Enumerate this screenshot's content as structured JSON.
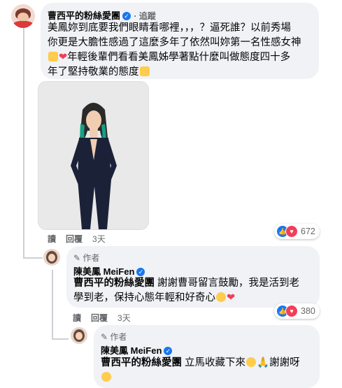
{
  "post_comment": {
    "author": "曹西平的粉絲愛團",
    "follow_label": "追蹤",
    "lines": [
      "美鳳妳到底要我們眼睛看哪裡，，，？逼死誰？以前秀場",
      "你更是大膽性感過了這麼多年了依然叫妳第一名性感女神",
      "年輕後輩們看看美鳳姊學著點什麼叫做態度四十多",
      "年了堅持敬業的態度"
    ],
    "actions": {
      "reply": "讀",
      "comment": "回覆",
      "time": "3天"
    },
    "reaction_count": "672"
  },
  "reply1": {
    "badge": "作者",
    "author": "陳美鳳 MeiFen",
    "mention": "曹西平的粉絲愛團",
    "line1_rest": "謝謝曹哥留言鼓勵，我是活到老",
    "line2": "學到老，保持心態年輕和好奇心",
    "actions": {
      "reply": "讀",
      "comment": "回覆",
      "time": "3天"
    },
    "reaction_count": "380"
  },
  "reply2": {
    "badge": "作者",
    "author": "陳美鳳 MeiFen",
    "mention": "曹西平的粉絲愛團",
    "rest": "立馬收藏下來",
    "thanks": "謝謝呀"
  },
  "colors": {
    "accent": "#1877f2",
    "heart": "#f33e58",
    "bubble": "#f0f2f5"
  }
}
